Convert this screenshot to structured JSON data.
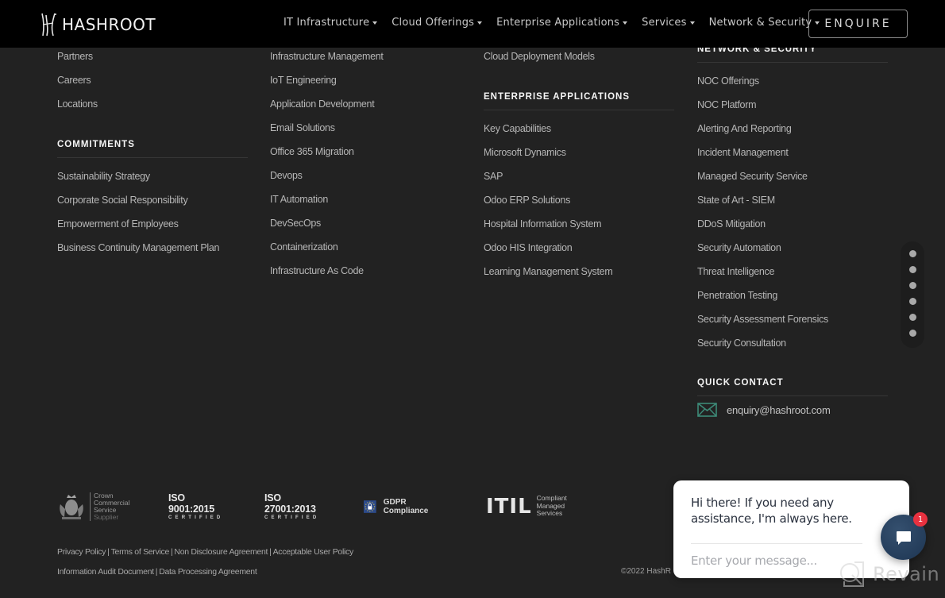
{
  "header": {
    "logo_text": "HASHROOT",
    "nav": [
      {
        "label": "IT Infrastructure"
      },
      {
        "label": "Cloud Offerings"
      },
      {
        "label": "Enterprise Applications"
      },
      {
        "label": "Services"
      },
      {
        "label": "Network & Security"
      }
    ],
    "enquire_label": "ENQUIRE"
  },
  "columns": {
    "company": {
      "links": [
        "Partners",
        "Careers",
        "Locations"
      ]
    },
    "commitments": {
      "heading": "COMMITMENTS",
      "links": [
        "Sustainability Strategy",
        "Corporate Social Responsibility",
        "Empowerment of Employees",
        "Business Continuity Management Plan"
      ]
    },
    "it_infrastructure": {
      "links": [
        "Infrastructure Management",
        "IoT Engineering",
        "Application Development",
        "Email Solutions",
        "Office 365 Migration",
        "Devops",
        "IT Automation",
        "DevSecOps",
        "Containerization",
        "Infrastructure As Code"
      ]
    },
    "cloud": {
      "links": [
        "Cloud Deployment Models"
      ]
    },
    "enterprise_applications": {
      "heading": "ENTERPRISE APPLICATIONS",
      "links": [
        "Key Capabilities",
        "Microsoft Dynamics",
        "SAP",
        "Odoo ERP Solutions",
        "Hospital Information System",
        "Odoo HIS Integration",
        "Learning Management System"
      ]
    },
    "network_security": {
      "heading": "NETWORK & SECURITY",
      "links": [
        "NOC Offerings",
        "NOC Platform",
        "Alerting And Reporting",
        "Incident Management",
        "Managed Security Service",
        "State of Art - SIEM",
        "DDoS Mitigation",
        "Security Automation",
        "Threat Intelligence",
        "Penetration Testing",
        "Security Assessment Forensics",
        "Security Consultation"
      ]
    },
    "quick_contact": {
      "heading": "QUICK CONTACT",
      "email": "enquiry@hashroot.com"
    }
  },
  "certifications": {
    "crown": {
      "lines": [
        "Crown",
        "Commercial",
        "Service"
      ],
      "supplier": "Supplier"
    },
    "iso9001": {
      "number": "ISO 9001:2015",
      "word": "CERTIFIED"
    },
    "iso27001": {
      "number": "ISO 27001:2013",
      "word": "CERTIFIED"
    },
    "gdpr": {
      "label": "GDPR Compliance"
    },
    "itil": {
      "word": "ITIL",
      "sub1": "Compliant",
      "sub2": "Managed Services"
    }
  },
  "legal": {
    "line1": [
      "Privacy Policy",
      "Terms of Service",
      "Non Disclosure Agreement",
      "Acceptable User Policy"
    ],
    "line2": [
      "Information Audit Document",
      "Data Processing Agreement"
    ],
    "separator": "|",
    "copyright": "©2022 HashR"
  },
  "dot_nav": {
    "count": 6
  },
  "chat": {
    "message": "Hi there! If you need any assistance, I'm always here.",
    "input_placeholder": "Enter your message...",
    "unread_count": "1"
  },
  "watermark": {
    "label": "Revain"
  },
  "colors": {
    "header_bg": "#000000",
    "footer_bg": "#222222",
    "link": "#b6b6b6",
    "heading": "#f5f5f5",
    "mail_icon": "#3d8a78",
    "chat_launcher": "#1d3552",
    "badge": "#e8313f"
  }
}
